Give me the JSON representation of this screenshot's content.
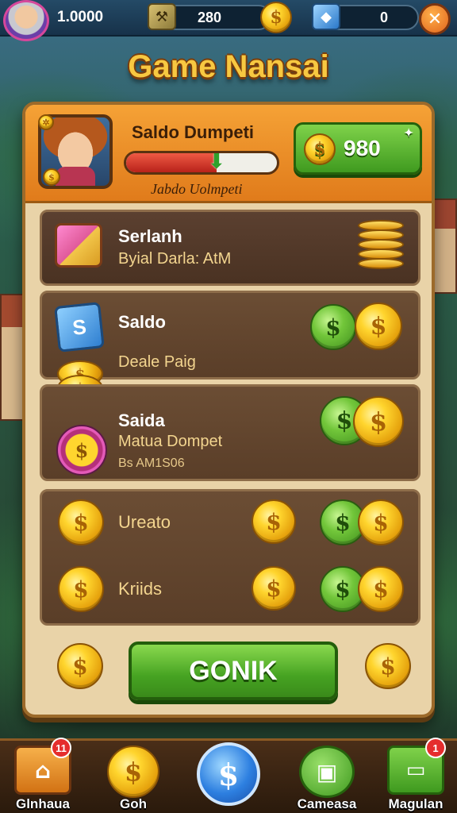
{
  "top_bar": {
    "player_name": "1.0000",
    "gold_count": "280",
    "gem_count": "0",
    "close_label": "✕"
  },
  "title": "Game Nansai",
  "header": {
    "label": "Saldo Dumpeti",
    "sublabel": "Jabdo Uolmpeti",
    "balance": "980",
    "progress_fraction": 0.6
  },
  "rows": [
    {
      "title": "Serlanh",
      "subtitle": "Byial Darla: AtM"
    },
    {
      "title": "Saldo",
      "subtitle": "Deale Paig"
    },
    {
      "title": "Saida",
      "subtitle": "Matua Dompet",
      "detail": "Bs AM1S06"
    },
    {
      "title": "Ureato"
    },
    {
      "title": "Kriids"
    }
  ],
  "action_button": "GONIK",
  "bottom_nav": [
    {
      "label": "Glnhaua",
      "badge": "11"
    },
    {
      "label": "Goh",
      "badge": ""
    },
    {
      "label": "",
      "badge": ""
    },
    {
      "label": "Cameasa",
      "badge": ""
    },
    {
      "label": "Magulan",
      "badge": "1"
    }
  ],
  "colors": {
    "accent_orange": "#e88a24",
    "button_green": "#46a322",
    "panel_brown": "#5a3e28",
    "title_gold": "#f7c841"
  }
}
